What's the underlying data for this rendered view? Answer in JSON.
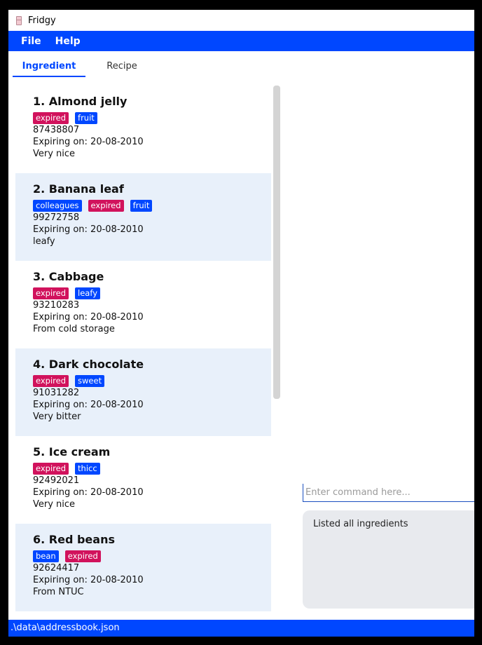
{
  "window": {
    "title": "Fridgy",
    "icon": "fridge-icon"
  },
  "menu": {
    "file": "File",
    "help": "Help"
  },
  "tabs": {
    "ingredient": "Ingredient",
    "recipe": "Recipe"
  },
  "ingredients": [
    {
      "title": "1.  Almond jelly",
      "tags": [
        {
          "label": "expired",
          "color": "#d1125c"
        },
        {
          "label": "fruit",
          "color": "#0047ff"
        }
      ],
      "id": "87438807",
      "expiry": "Expiring on: 20-08-2010",
      "note": "Very nice"
    },
    {
      "title": "2.  Banana leaf",
      "tags": [
        {
          "label": "colleagues",
          "color": "#0047ff"
        },
        {
          "label": "expired",
          "color": "#d1125c"
        },
        {
          "label": "fruit",
          "color": "#0047ff"
        }
      ],
      "id": "99272758",
      "expiry": "Expiring on: 20-08-2010",
      "note": "leafy"
    },
    {
      "title": "3.  Cabbage",
      "tags": [
        {
          "label": "expired",
          "color": "#d1125c"
        },
        {
          "label": "leafy",
          "color": "#0047ff"
        }
      ],
      "id": "93210283",
      "expiry": "Expiring on: 20-08-2010",
      "note": "From cold storage"
    },
    {
      "title": "4.  Dark chocolate",
      "tags": [
        {
          "label": "expired",
          "color": "#d1125c"
        },
        {
          "label": "sweet",
          "color": "#0047ff"
        }
      ],
      "id": "91031282",
      "expiry": "Expiring on: 20-08-2010",
      "note": "Very bitter"
    },
    {
      "title": "5.  Ice cream",
      "tags": [
        {
          "label": "expired",
          "color": "#d1125c"
        },
        {
          "label": "thicc",
          "color": "#0047ff"
        }
      ],
      "id": "92492021",
      "expiry": "Expiring on: 20-08-2010",
      "note": "Very nice"
    },
    {
      "title": "6.  Red beans",
      "tags": [
        {
          "label": "bean",
          "color": "#0047ff"
        },
        {
          "label": "expired",
          "color": "#d1125c"
        }
      ],
      "id": "92624417",
      "expiry": "Expiring on: 20-08-2010",
      "note": "From NTUC"
    }
  ],
  "command": {
    "placeholder": "Enter command here...",
    "value": ""
  },
  "result": {
    "text": "Listed all ingredients"
  },
  "status": {
    "path": ".\\data\\addressbook.json"
  },
  "colors": {
    "accent": "#0047ff",
    "expired": "#d1125c",
    "alt_row": "#e8f0fa"
  }
}
